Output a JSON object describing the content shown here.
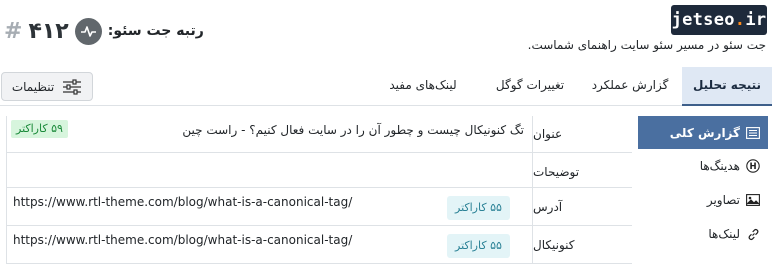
{
  "header": {
    "logo_main": "jetseo",
    "logo_dot": ".",
    "logo_tld": "ir",
    "rank_title": "رتبه جت سئو:",
    "rank_value": "۴۱۲",
    "rank_hash": "#",
    "subtitle": "جت سئو در مسیر سئو سایت راهنمای شماست."
  },
  "tabs": [
    {
      "label": "نتیجه تحلیل",
      "active": true
    },
    {
      "label": "گزارش عملکرد",
      "active": false
    },
    {
      "label": "تغییرات گوگل",
      "active": false
    },
    {
      "label": "لینک‌های مفید",
      "active": false
    }
  ],
  "settings": {
    "label": "تنظیمات"
  },
  "sidenav": [
    {
      "label": "گزارش کلی",
      "icon": "list-icon",
      "active": true
    },
    {
      "label": "هدینگ‌ها",
      "icon": "heading-icon",
      "active": false
    },
    {
      "label": "تصاویر",
      "icon": "image-icon",
      "active": false
    },
    {
      "label": "لینک‌ها",
      "icon": "link-icon",
      "active": false
    }
  ],
  "report": {
    "rows": [
      {
        "label": "عنوان",
        "value": "تگ کنونیکال چیست و چطور آن را در سایت فعال کنیم؟ - راست چین",
        "badge": "۵۹ کاراکتر"
      },
      {
        "label": "توضیحات",
        "value": "",
        "badge": ""
      },
      {
        "label": "آدرس",
        "value": "https://www.rtl-theme.com/blog/what-is-a-canonical-tag/",
        "badge": "۵۵ کاراکتر"
      },
      {
        "label": "کنونیکال",
        "value": "https://www.rtl-theme.com/blog/what-is-a-canonical-tag/",
        "badge": "۵۵ کاراکتر"
      }
    ]
  },
  "colors": {
    "accent": "#4a6fa0",
    "tab_active_bg": "#dfe8f4",
    "badge_green_bg": "#d7f5dd",
    "badge_green_text": "#1b8a3a",
    "badge_blue_bg": "#e3f4f7",
    "badge_blue_text": "#2b8296",
    "logo_bg": "#1e2a3b"
  }
}
